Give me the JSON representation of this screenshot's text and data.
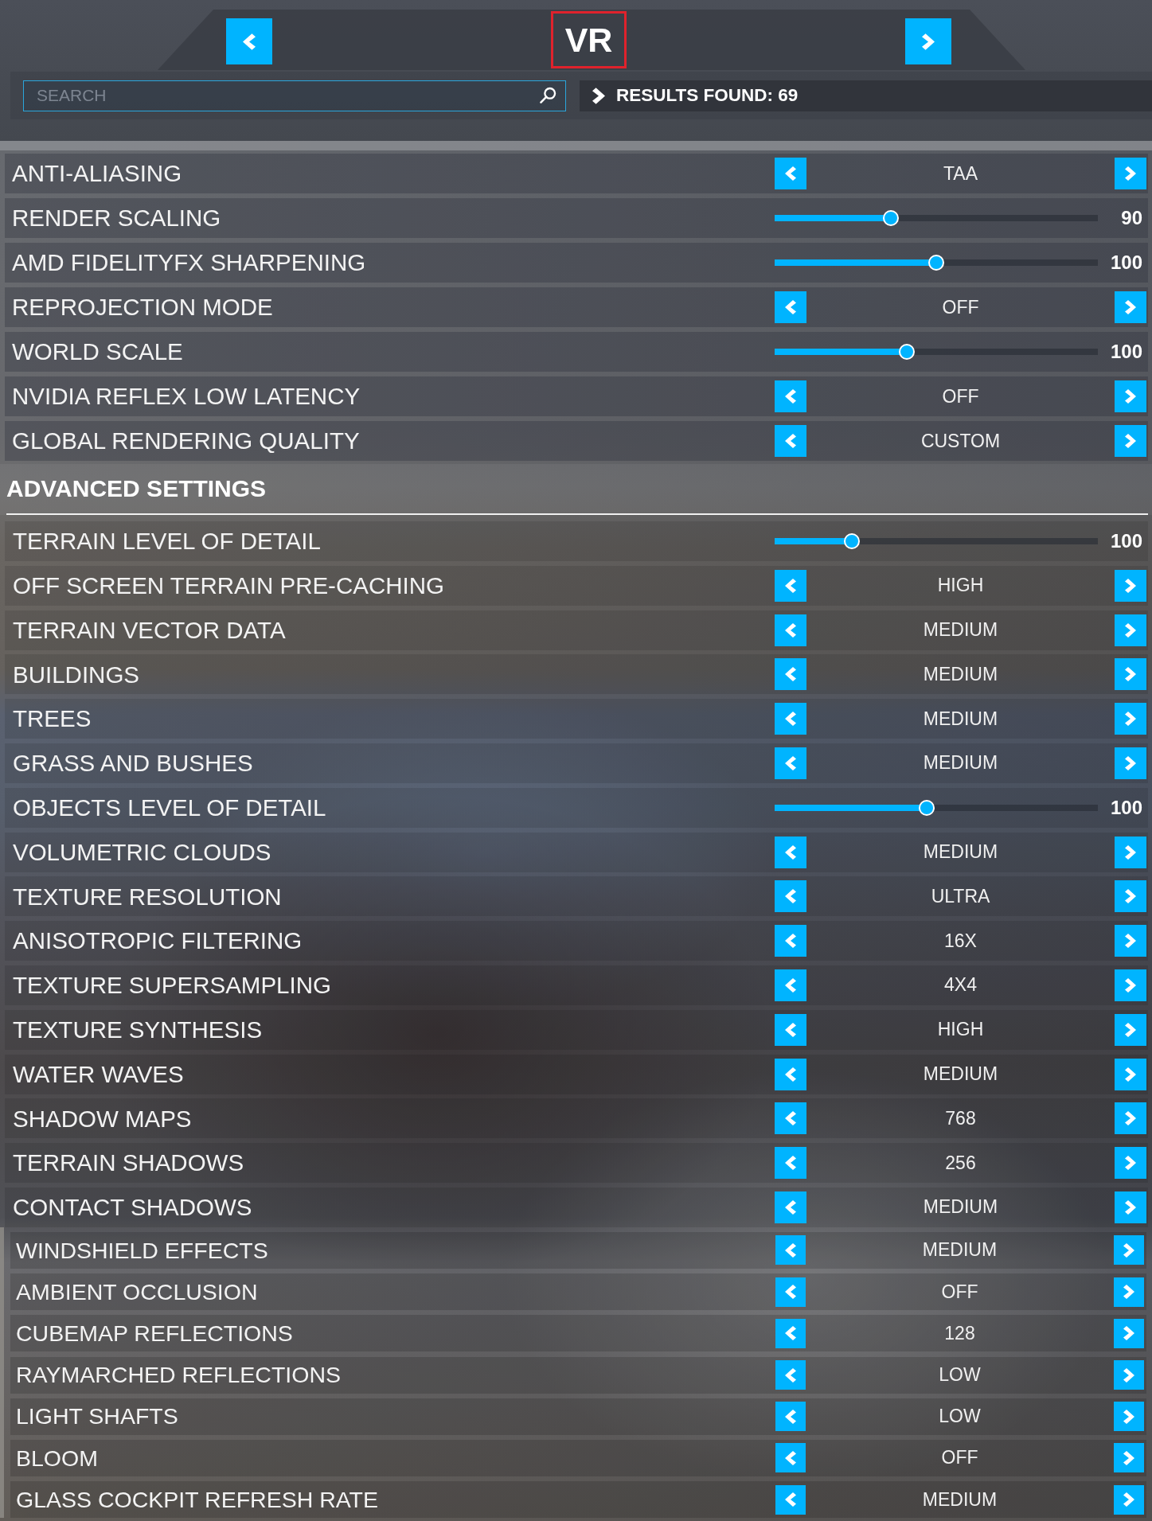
{
  "tab_header": {
    "title": "VR"
  },
  "search": {
    "placeholder": "SEARCH"
  },
  "results": {
    "text": "RESULTS FOUND: 69"
  },
  "settings": [
    {
      "kind": "selector",
      "label": "ANTI-ALIASING",
      "value": "TAA"
    },
    {
      "kind": "slider",
      "label": "RENDER SCALING",
      "level": 0.36,
      "reading": "90"
    },
    {
      "kind": "slider",
      "label": "AMD FIDELITYFX SHARPENING",
      "level": 0.5,
      "reading": "100"
    },
    {
      "kind": "selector",
      "label": "REPROJECTION MODE",
      "value": "OFF"
    },
    {
      "kind": "slider",
      "label": "WORLD SCALE",
      "level": 0.41,
      "reading": "100"
    },
    {
      "kind": "selector",
      "label": "NVIDIA REFLEX LOW LATENCY",
      "value": "OFF"
    },
    {
      "kind": "selector",
      "label": "GLOBAL RENDERING QUALITY",
      "value": "CUSTOM"
    }
  ],
  "advanced_settings": {
    "title": "ADVANCED SETTINGS",
    "items": [
      {
        "kind": "slider",
        "label": "TERRAIN LEVEL OF DETAIL",
        "level": 0.24,
        "reading": "100"
      },
      {
        "kind": "selector",
        "label": "OFF SCREEN TERRAIN PRE-CACHING",
        "value": "HIGH"
      },
      {
        "kind": "selector",
        "label": "TERRAIN VECTOR DATA",
        "value": "MEDIUM"
      },
      {
        "kind": "selector",
        "label": "BUILDINGS",
        "value": "MEDIUM"
      },
      {
        "kind": "selector",
        "label": "TREES",
        "value": "MEDIUM"
      },
      {
        "kind": "selector",
        "label": "GRASS AND BUSHES",
        "value": "MEDIUM"
      },
      {
        "kind": "slider",
        "label": "OBJECTS LEVEL OF DETAIL",
        "level": 0.47,
        "reading": "100"
      },
      {
        "kind": "selector",
        "label": "VOLUMETRIC CLOUDS",
        "value": "MEDIUM"
      },
      {
        "kind": "selector",
        "label": "TEXTURE RESOLUTION",
        "value": "ULTRA"
      },
      {
        "kind": "selector",
        "label": "ANISOTROPIC FILTERING",
        "value": "16X"
      },
      {
        "kind": "selector",
        "label": "TEXTURE SUPERSAMPLING",
        "value": "4X4"
      },
      {
        "kind": "selector",
        "label": "TEXTURE SYNTHESIS",
        "value": "HIGH"
      },
      {
        "kind": "selector",
        "label": "WATER WAVES",
        "value": "MEDIUM"
      },
      {
        "kind": "selector",
        "label": "SHADOW MAPS",
        "value": "768"
      },
      {
        "kind": "selector",
        "label": "TERRAIN SHADOWS",
        "value": "256"
      },
      {
        "kind": "selector",
        "label": "CONTACT SHADOWS",
        "value": "MEDIUM"
      }
    ],
    "continued_items": [
      {
        "kind": "selector",
        "label": "WINDSHIELD EFFECTS",
        "value": "MEDIUM"
      },
      {
        "kind": "selector",
        "label": "AMBIENT OCCLUSION",
        "value": "OFF"
      },
      {
        "kind": "selector",
        "label": "CUBEMAP REFLECTIONS",
        "value": "128"
      },
      {
        "kind": "selector",
        "label": "RAYMARCHED REFLECTIONS",
        "value": "LOW"
      },
      {
        "kind": "selector",
        "label": "LIGHT SHAFTS",
        "value": "LOW"
      },
      {
        "kind": "selector",
        "label": "BLOOM",
        "value": "OFF"
      },
      {
        "kind": "selector",
        "label": "GLASS COCKPIT REFRESH RATE",
        "value": "MEDIUM"
      }
    ]
  }
}
